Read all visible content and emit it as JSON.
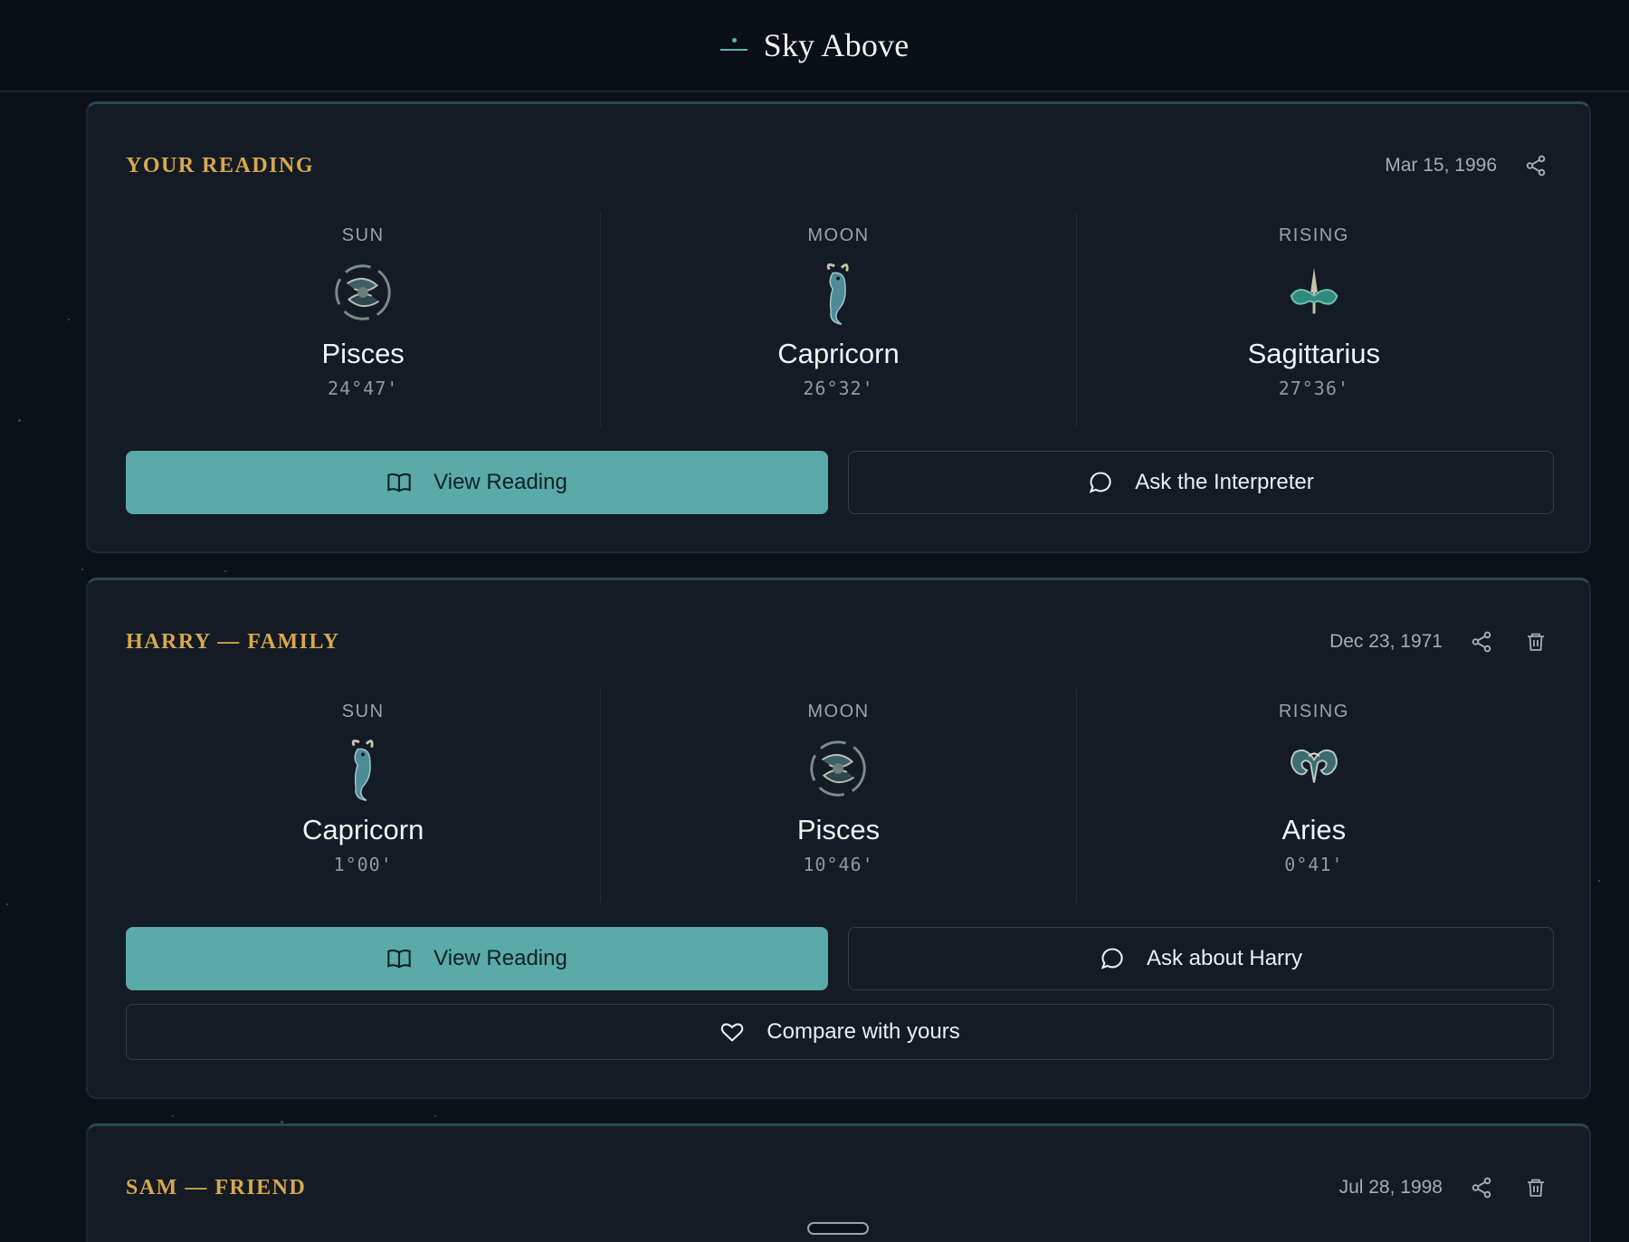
{
  "app": {
    "title": "Sky Above"
  },
  "cards": [
    {
      "title": "YOUR READING",
      "date": "Mar 15, 1996",
      "placements": [
        {
          "label": "SUN",
          "sign": "Pisces",
          "degree": "24°47'",
          "glyph": "pisces-icon"
        },
        {
          "label": "MOON",
          "sign": "Capricorn",
          "degree": "26°32'",
          "glyph": "capricorn-icon"
        },
        {
          "label": "RISING",
          "sign": "Sagittarius",
          "degree": "27°36'",
          "glyph": "sagittarius-icon"
        }
      ],
      "primary_label": "View Reading",
      "secondary_label": "Ask the Interpreter"
    },
    {
      "title": "HARRY — FAMILY",
      "date": "Dec 23, 1971",
      "placements": [
        {
          "label": "SUN",
          "sign": "Capricorn",
          "degree": "1°00'",
          "glyph": "capricorn-icon"
        },
        {
          "label": "MOON",
          "sign": "Pisces",
          "degree": "10°46'",
          "glyph": "pisces-icon"
        },
        {
          "label": "RISING",
          "sign": "Aries",
          "degree": "0°41'",
          "glyph": "aries-icon"
        }
      ],
      "primary_label": "View Reading",
      "secondary_label": "Ask about Harry",
      "compare_label": "Compare with yours"
    },
    {
      "title": "SAM — FRIEND",
      "date": "Jul 28, 1998"
    }
  ],
  "colors": {
    "accent": "#59aaa8",
    "gold": "#d9a84a",
    "background": "#0c1118",
    "card": "#141b25"
  },
  "icons": [
    "book-icon",
    "chat-bubble-icon",
    "share-icon",
    "trash-icon",
    "heart-icon"
  ]
}
